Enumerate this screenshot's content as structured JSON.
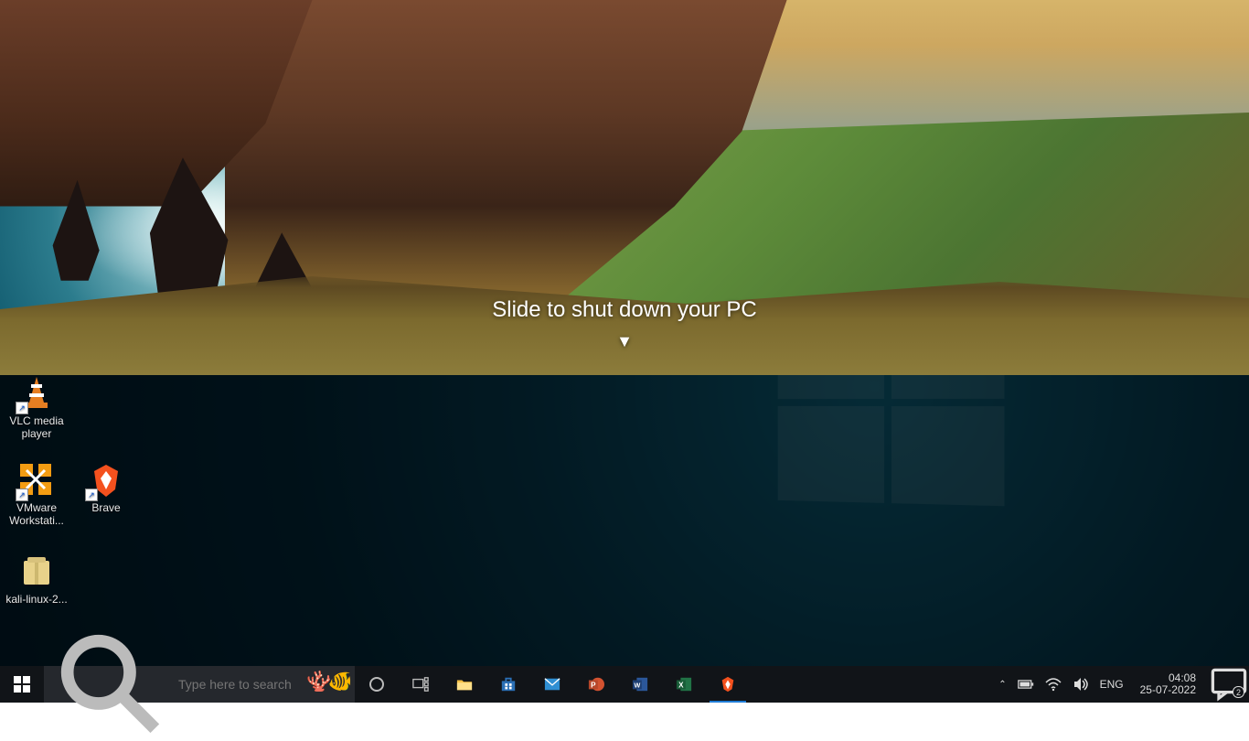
{
  "shutdown_overlay": {
    "message": "Slide to shut down your PC",
    "arrow_glyph": "▼"
  },
  "desktop_icons": {
    "vlc": {
      "label": "VLC media player"
    },
    "vmware": {
      "label": "VMware Workstati..."
    },
    "brave": {
      "label": "Brave"
    },
    "kali": {
      "label": "kali-linux-2..."
    }
  },
  "taskbar": {
    "search_placeholder": "Type here to search",
    "apps": {
      "cortana": {
        "name": "cortana"
      },
      "taskview": {
        "name": "task-view"
      },
      "explorer": {
        "name": "file-explorer"
      },
      "store": {
        "name": "microsoft-store"
      },
      "mail": {
        "name": "mail"
      },
      "powerpoint": {
        "name": "powerpoint",
        "letter": "P"
      },
      "word": {
        "name": "word",
        "letter": "W"
      },
      "excel": {
        "name": "excel",
        "letter": "X"
      },
      "brave": {
        "name": "brave",
        "active": true
      }
    }
  },
  "tray": {
    "language": "ENG",
    "time": "04:08",
    "date": "25-07-2022",
    "notification_count": "2"
  }
}
